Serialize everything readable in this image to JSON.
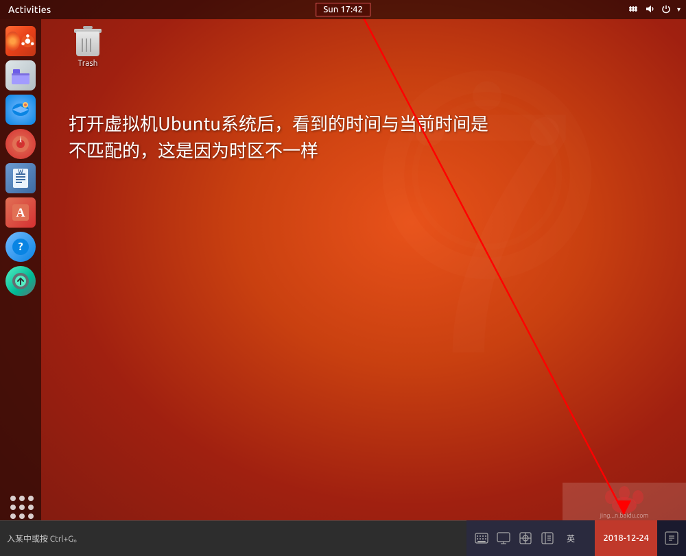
{
  "topbar": {
    "activities_label": "Activities",
    "clock": "Sun 17:42",
    "network_icon": "⬡",
    "volume_icon": "🔊",
    "power_icon": "⏻"
  },
  "desktop": {
    "trash_label": "Trash",
    "annotation": "打开虚拟机Ubuntu系统后，看到的时间与当前时间是\n不匹配的，这是因为时区不一样"
  },
  "sidebar": {
    "apps": [
      {
        "name": "Ubuntu Software",
        "icon_type": "ubuntu"
      },
      {
        "name": "Files",
        "icon_type": "files"
      },
      {
        "name": "Thunderbird",
        "icon_type": "thunderbird"
      },
      {
        "name": "Rhythmbox",
        "icon_type": "rhythmbox"
      },
      {
        "name": "LibreOffice Writer",
        "icon_type": "writer"
      },
      {
        "name": "Font Manager",
        "icon_type": "font"
      },
      {
        "name": "Help",
        "icon_type": "help"
      },
      {
        "name": "Software Updater",
        "icon_type": "update"
      }
    ]
  },
  "bottombar": {
    "hint_text": "入某中或按 Ctrl+G。",
    "date": "2018-12-24",
    "lang": "英",
    "icons": [
      "keyboard",
      "display",
      "network",
      "sidebar-toggle"
    ]
  }
}
